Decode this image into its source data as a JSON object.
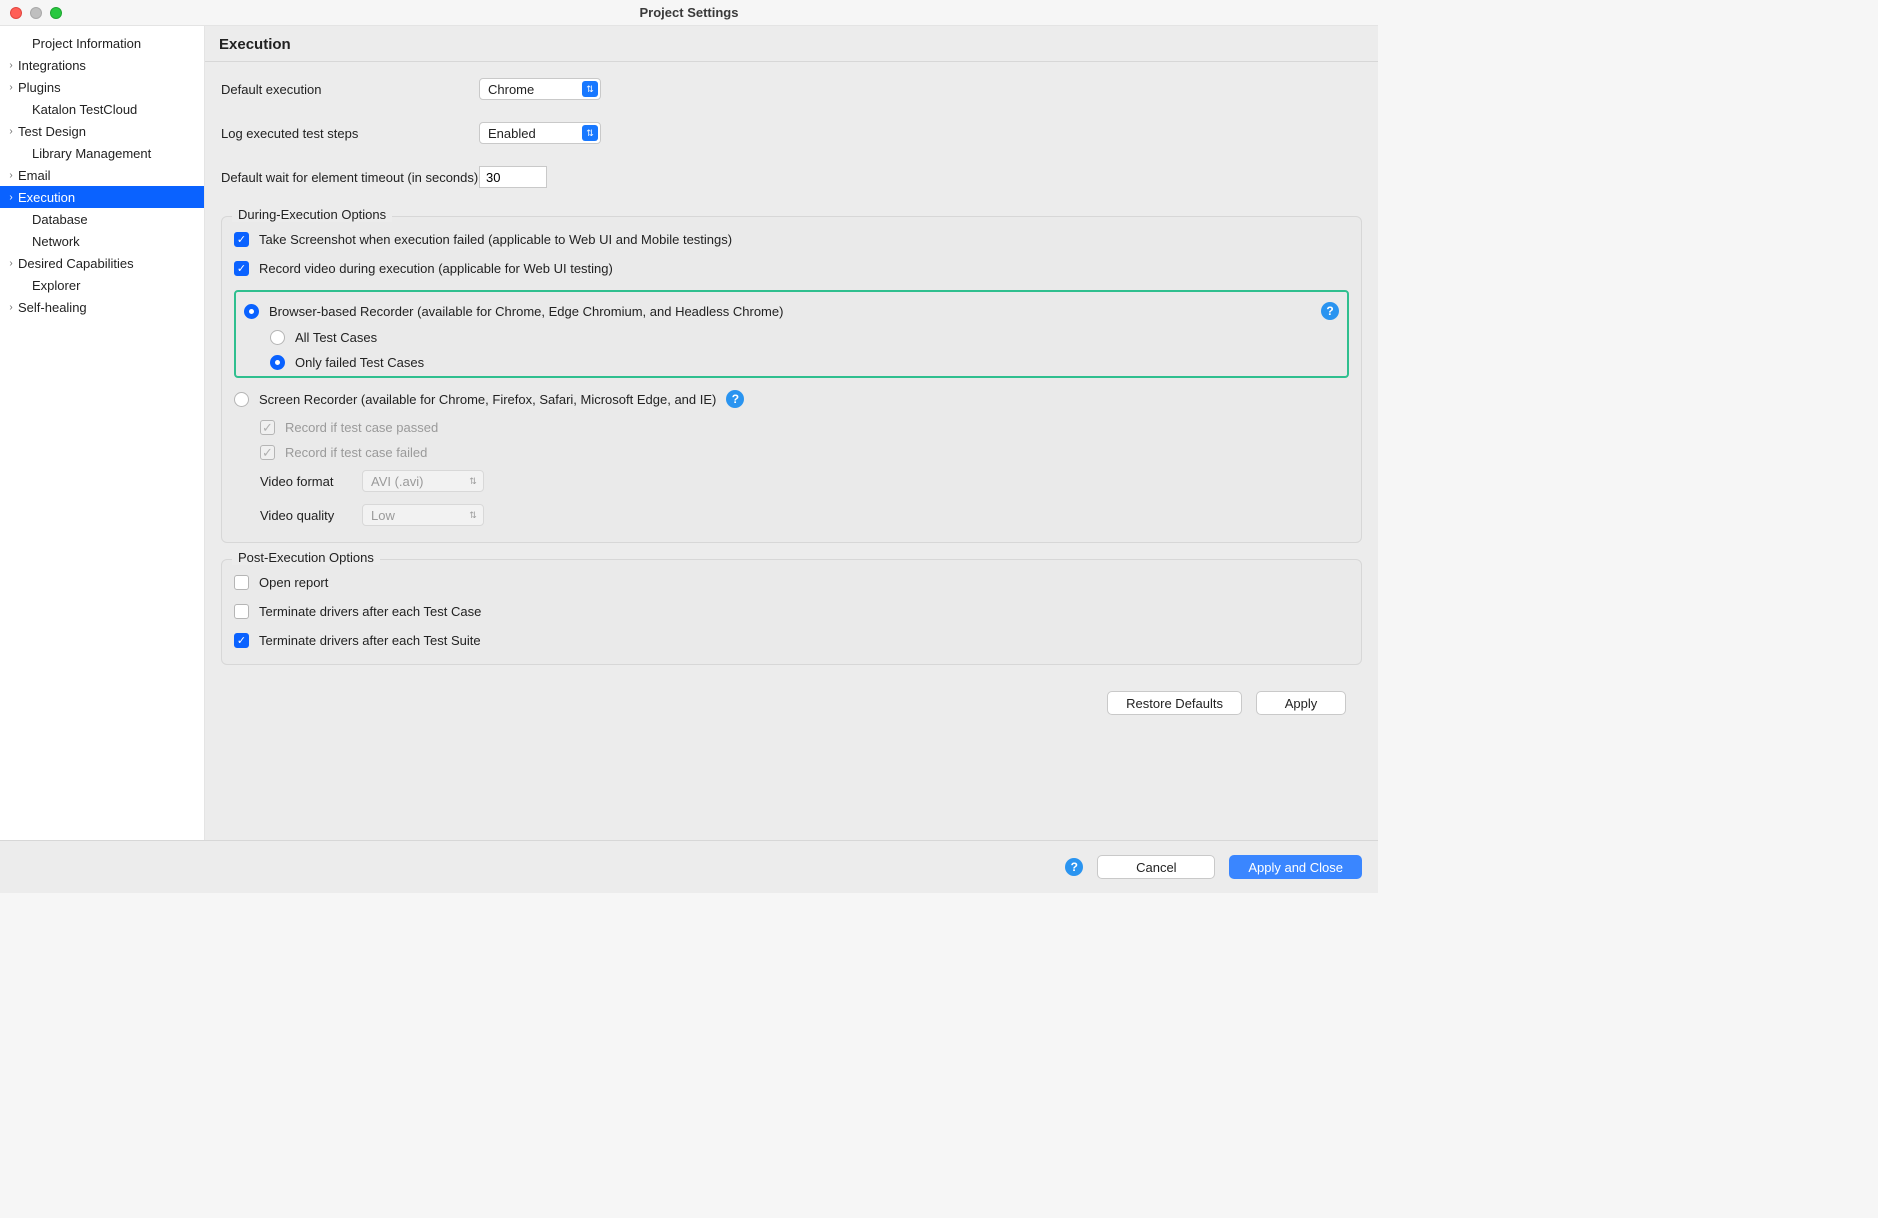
{
  "window": {
    "title": "Project Settings"
  },
  "sidebar": {
    "items": [
      {
        "label": "Project Information",
        "expandable": false,
        "indent": true
      },
      {
        "label": "Integrations",
        "expandable": true
      },
      {
        "label": "Plugins",
        "expandable": true
      },
      {
        "label": "Katalon TestCloud",
        "expandable": false,
        "indent": true
      },
      {
        "label": "Test Design",
        "expandable": true
      },
      {
        "label": "Library Management",
        "expandable": false,
        "indent": true
      },
      {
        "label": "Email",
        "expandable": true
      },
      {
        "label": "Execution",
        "expandable": true,
        "selected": true
      },
      {
        "label": "Database",
        "expandable": false,
        "indent": true
      },
      {
        "label": "Network",
        "expandable": false,
        "indent": true
      },
      {
        "label": "Desired Capabilities",
        "expandable": true
      },
      {
        "label": "Explorer",
        "expandable": false,
        "indent": true
      },
      {
        "label": "Self-healing",
        "expandable": true
      }
    ]
  },
  "content": {
    "header": "Execution",
    "defaultExecution": {
      "label": "Default execution",
      "value": "Chrome"
    },
    "logSteps": {
      "label": "Log executed test steps",
      "value": "Enabled"
    },
    "waitTimeout": {
      "label": "Default wait for element timeout (in seconds)",
      "value": "30"
    },
    "during": {
      "title": "During-Execution Options",
      "takeScreenshot": {
        "label": "Take Screenshot when execution failed (applicable to Web UI and Mobile testings)",
        "checked": true
      },
      "recordVideo": {
        "label": "Record video during execution (applicable for Web UI testing)",
        "checked": true
      },
      "browserBased": {
        "label": "Browser-based Recorder (available for Chrome, Edge Chromium, and Headless Chrome)",
        "selected": true,
        "allTestCases": {
          "label": "All Test Cases",
          "selected": false
        },
        "onlyFailed": {
          "label": "Only failed Test Cases",
          "selected": true
        }
      },
      "screenRecorder": {
        "label": "Screen Recorder (available for Chrome, Firefox, Safari, Microsoft Edge, and IE)",
        "selected": false,
        "recordPassed": {
          "label": "Record if test case passed",
          "checked": true
        },
        "recordFailed": {
          "label": "Record if test case failed",
          "checked": true
        },
        "videoFormat": {
          "label": "Video format",
          "value": "AVI (.avi)"
        },
        "videoQuality": {
          "label": "Video quality",
          "value": "Low"
        }
      }
    },
    "post": {
      "title": "Post-Execution Options",
      "openReport": {
        "label": "Open report",
        "checked": false
      },
      "terminateCase": {
        "label": "Terminate drivers after each Test Case",
        "checked": false
      },
      "terminateSuite": {
        "label": "Terminate drivers after each Test Suite",
        "checked": true
      }
    },
    "buttons": {
      "restoreDefaults": "Restore Defaults",
      "apply": "Apply",
      "cancel": "Cancel",
      "applyClose": "Apply and Close"
    }
  }
}
